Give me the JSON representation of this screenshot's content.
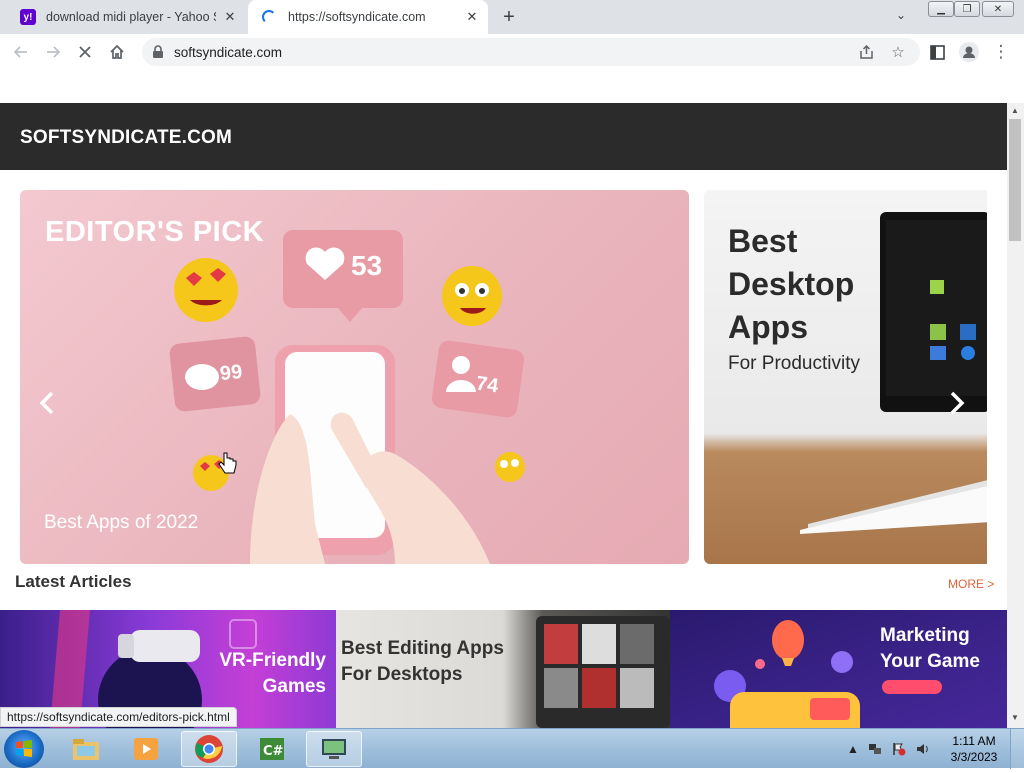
{
  "browser": {
    "tabs": [
      {
        "title": "download midi player - Yahoo Se",
        "favicon": "yahoo-icon",
        "active": false
      },
      {
        "title": "https://softsyndicate.com",
        "favicon": "loading-spinner-icon",
        "active": true
      }
    ],
    "url": "softsyndicate.com",
    "status_url": "https://softsyndicate.com/editors-pick.html"
  },
  "site": {
    "logo": "SOFTSYNDICATE.COM",
    "carousel": {
      "slides": [
        {
          "title": "EDITOR'S PICK",
          "subtitle": "Best Apps of 2022",
          "badges": [
            "53",
            "99",
            "74"
          ]
        },
        {
          "title": "Best Desktop Apps",
          "subtitle": "For Productivity"
        }
      ]
    },
    "latest": {
      "heading": "Latest Articles",
      "more": "MORE >",
      "articles": [
        {
          "title": "VR-Friendly Games"
        },
        {
          "title": "Best Editing Apps For Desktops"
        },
        {
          "title": "Marketing Your Game"
        }
      ]
    }
  },
  "taskbar": {
    "time": "1:11 AM",
    "date": "3/3/2023",
    "apps": [
      "explorer-icon",
      "media-player-icon",
      "chrome-icon",
      "csharp-icon",
      "remote-desktop-icon"
    ]
  },
  "colors": {
    "accent_more": "#e0623a",
    "header_bg": "#2b2b2b"
  }
}
